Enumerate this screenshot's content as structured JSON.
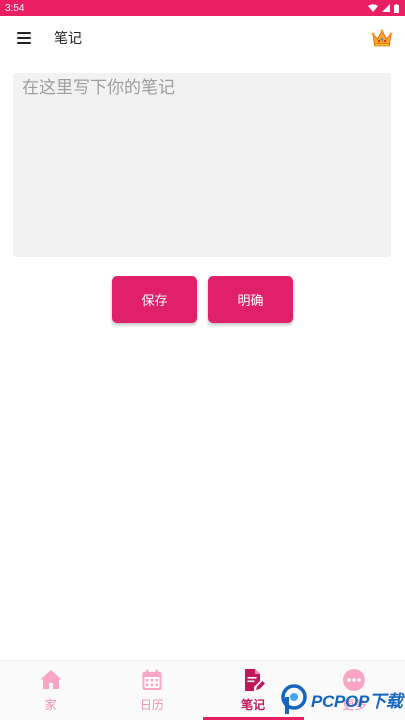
{
  "status_bar": {
    "time": "3:54",
    "icons": [
      "wifi-icon",
      "signal-icon",
      "battery-icon"
    ]
  },
  "app_bar": {
    "title": "笔记",
    "menu_icon": "hamburger-menu-icon",
    "premium_icon": "crown-icon"
  },
  "note": {
    "value": "",
    "placeholder": "在这里写下你的笔记"
  },
  "buttons": {
    "save_label": "保存",
    "confirm_label": "明确"
  },
  "bottom_nav": {
    "items": [
      {
        "label": "家",
        "icon": "home-icon",
        "active": false
      },
      {
        "label": "日历",
        "icon": "calendar-icon",
        "active": false
      },
      {
        "label": "笔记",
        "icon": "note-icon",
        "active": true
      },
      {
        "label": "更多",
        "icon": "more-icon",
        "active": false
      }
    ]
  },
  "watermark": {
    "brand": "PCPOP",
    "suffix": "下载"
  },
  "colors": {
    "primary": "#e91e63",
    "button": "#e0206a",
    "nav_inactive": "#f48fb1",
    "nav_active": "#c2185b",
    "note_bg": "#f2f2f2"
  }
}
